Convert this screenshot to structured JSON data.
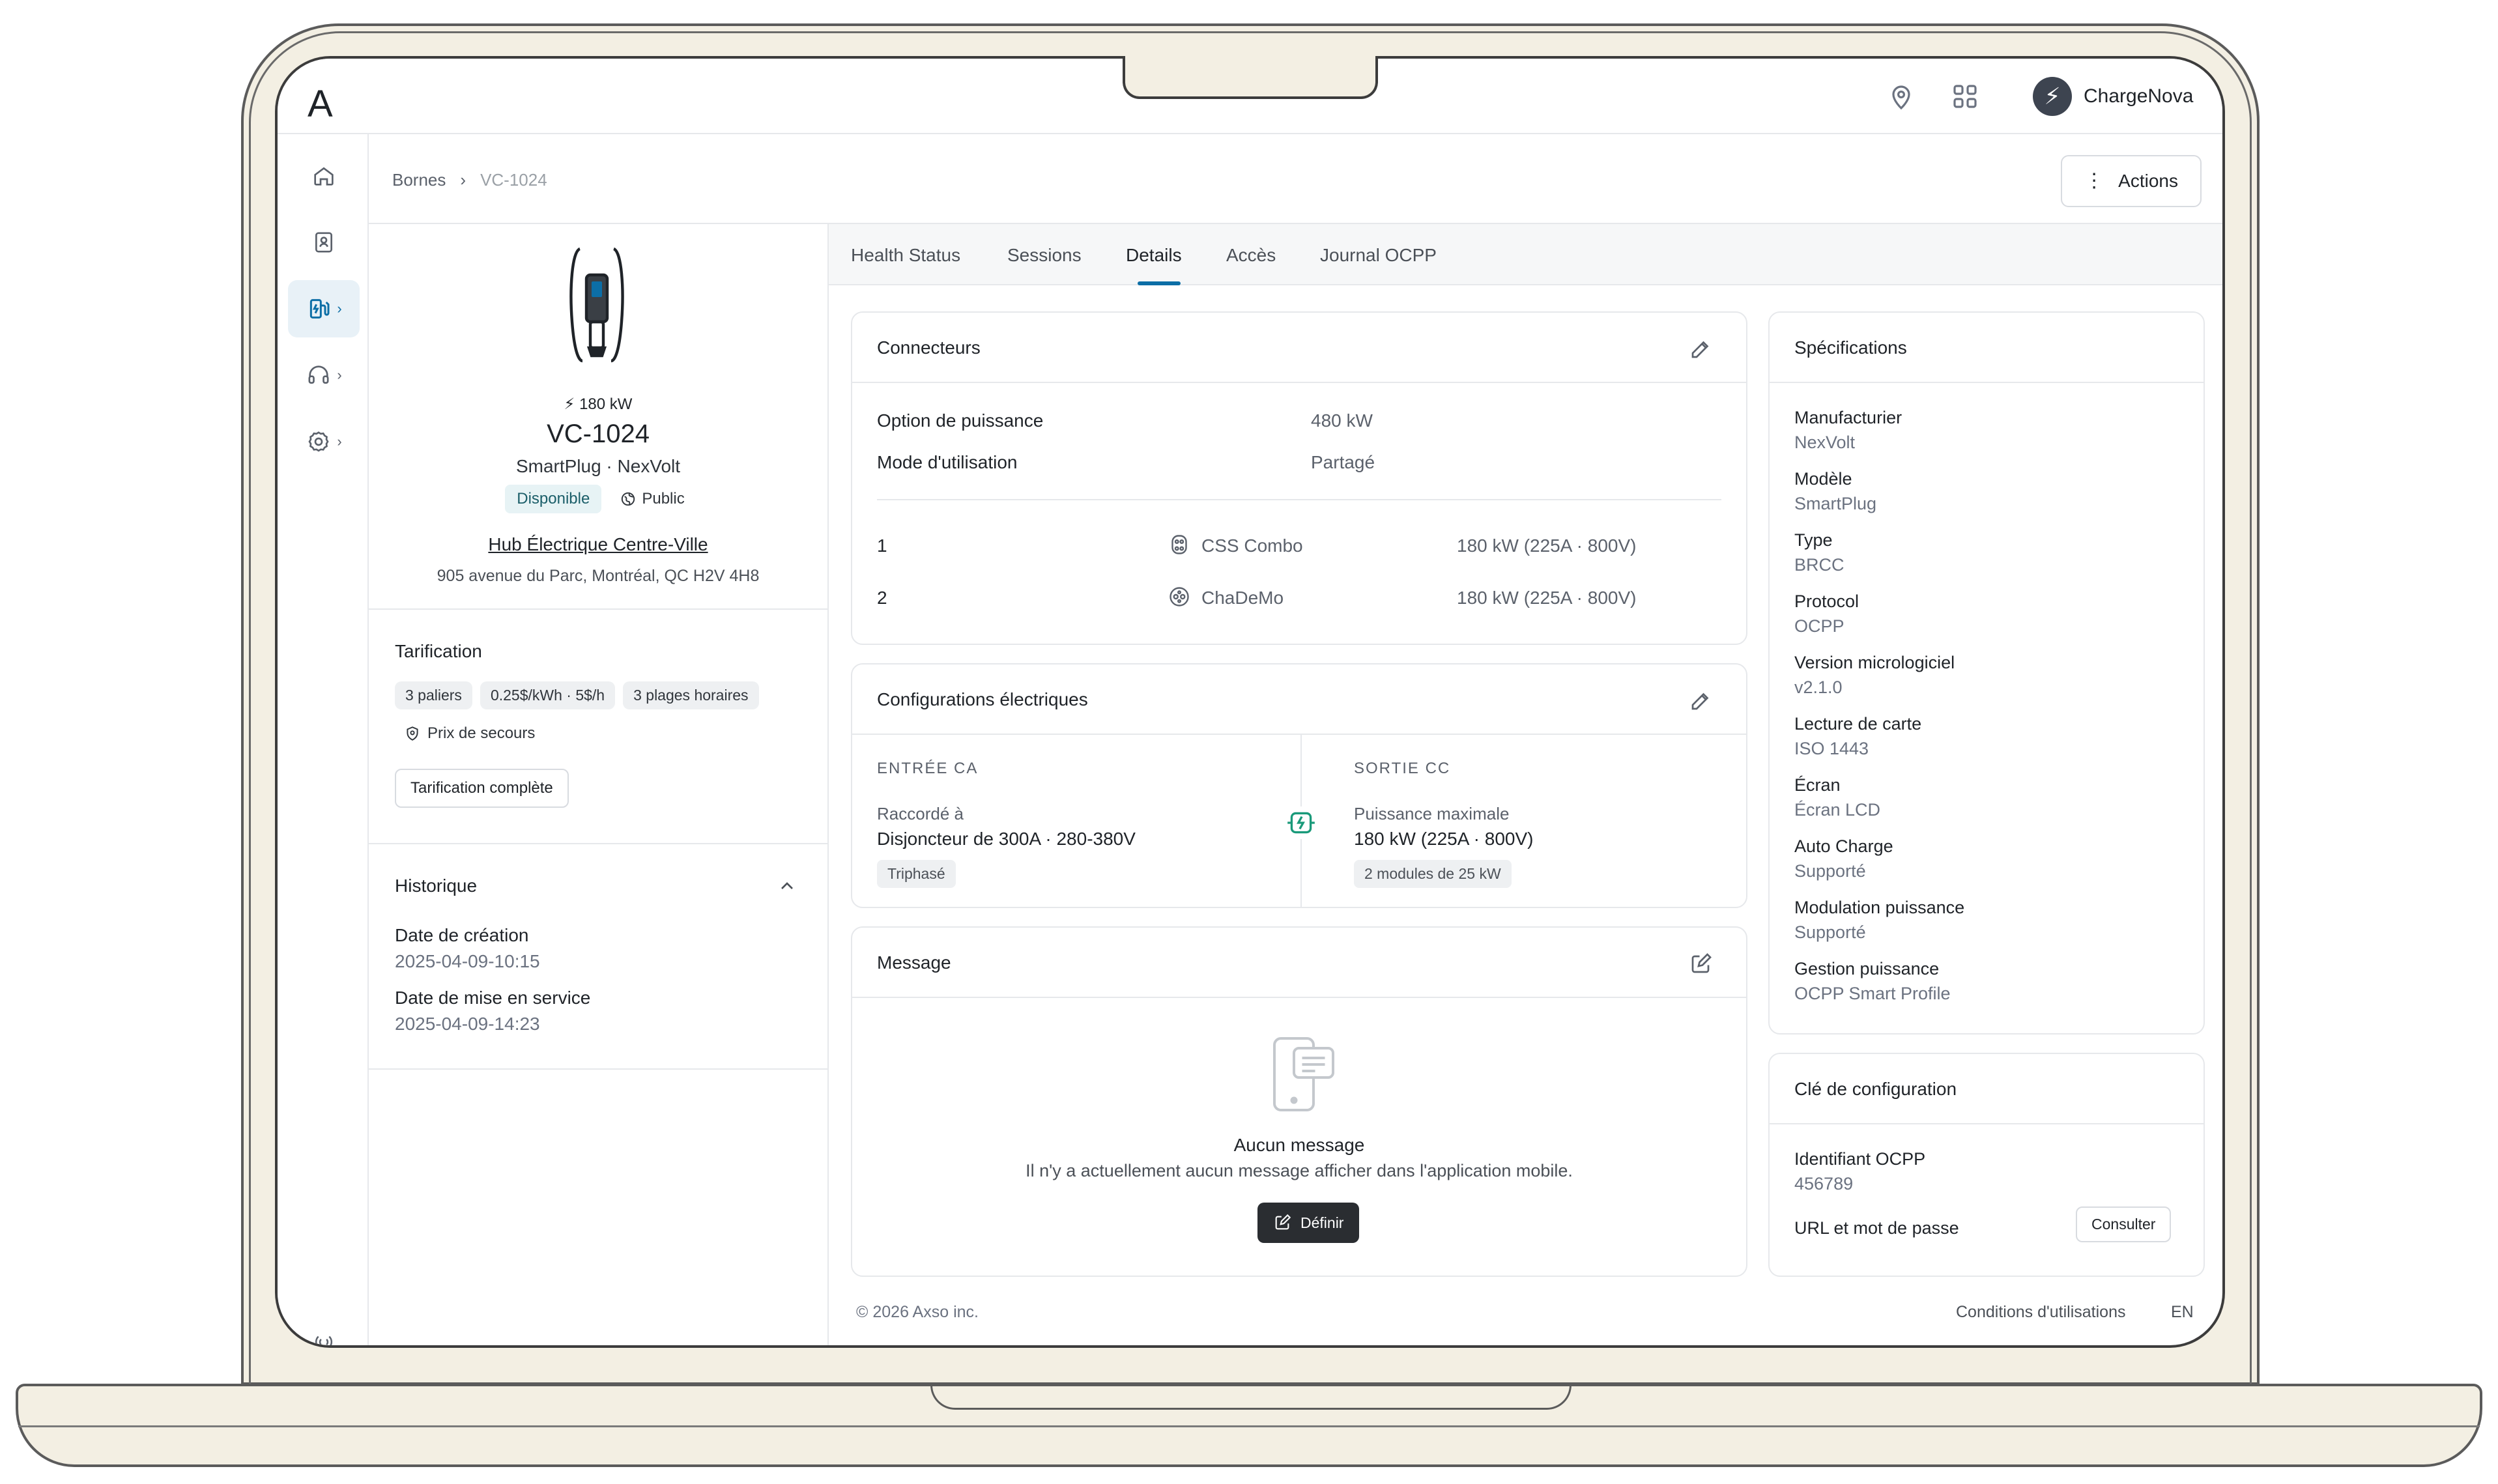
{
  "app": {
    "logo": "A",
    "user_name": "ChargeNova"
  },
  "breadcrumb": {
    "root": "Bornes",
    "separator": "›",
    "current": "VC-1024"
  },
  "actions_label": "Actions",
  "device": {
    "power": "180 kW",
    "name": "VC-1024",
    "model_brand": "SmartPlug · NexVolt",
    "status_badge": "Disponible",
    "access_badge": "Public",
    "site_name": "Hub Électrique Centre-Ville",
    "site_address": "905 avenue du Parc, Montréal, QC H2V 4H8"
  },
  "pricing": {
    "title": "Tarification",
    "chips": [
      "3 paliers",
      "0.25$/kWh · 5$/h",
      "3 plages horaires"
    ],
    "backup_label": "Prix de secours",
    "full_button": "Tarification complète"
  },
  "history": {
    "title": "Historique",
    "created_label": "Date de création",
    "created_value": "2025-04-09-10:15",
    "commissioned_label": "Date de mise en service",
    "commissioned_value": "2025-04-09-14:23"
  },
  "tabs": [
    "Health Status",
    "Sessions",
    "Details",
    "Accès",
    "Journal OCPP"
  ],
  "active_tab": "Details",
  "connectors": {
    "title": "Connecteurs",
    "power_option_label": "Option de puissance",
    "power_option_value": "480 kW",
    "usage_mode_label": "Mode d'utilisation",
    "usage_mode_value": "Partagé",
    "rows": [
      {
        "id": "1",
        "type": "CSS Combo",
        "spec": "180 kW (225A · 800V)"
      },
      {
        "id": "2",
        "type": "ChaDeMo",
        "spec": "180 kW (225A · 800V)"
      }
    ]
  },
  "electrical": {
    "title": "Configurations électriques",
    "ac_caption": "ENTRÉE CA",
    "ac_label": "Raccordé à",
    "ac_value": "Disjoncteur de 300A · 280-380V",
    "ac_pill": "Triphasé",
    "dc_caption": "SORTIE CC",
    "dc_label": "Puissance maximale",
    "dc_value": "180 kW (225A · 800V)",
    "dc_pill": "2 modules de 25 kW"
  },
  "message": {
    "title": "Message",
    "empty_title": "Aucun message",
    "empty_desc": "Il n'y a actuellement aucun message afficher dans l'application mobile.",
    "define_button": "Définir"
  },
  "specs": {
    "title": "Spécifications",
    "items": [
      {
        "k": "Manufacturier",
        "v": "NexVolt"
      },
      {
        "k": "Modèle",
        "v": "SmartPlug"
      },
      {
        "k": "Type",
        "v": "BRCC"
      },
      {
        "k": "Protocol",
        "v": "OCPP"
      },
      {
        "k": "Version micrologiciel",
        "v": "v2.1.0"
      },
      {
        "k": "Lecture de carte",
        "v": "ISO 1443"
      },
      {
        "k": "Écran",
        "v": "Écran LCD"
      },
      {
        "k": "Auto Charge",
        "v": "Supporté"
      },
      {
        "k": "Modulation puissance",
        "v": "Supporté"
      },
      {
        "k": "Gestion puissance",
        "v": "OCPP Smart Profile"
      }
    ]
  },
  "config_key": {
    "title": "Clé de configuration",
    "ocpp_id_label": "Identifiant OCPP",
    "ocpp_id_value": "456789",
    "url_label": "URL et mot de passe",
    "consult_button": "Consulter"
  },
  "footer": {
    "copyright": "© 2026 Axso inc.",
    "terms": "Conditions d'utilisations",
    "lang": "EN"
  },
  "colors": {
    "accent": "#0c6ea6",
    "status_green_bg": "#e7f3f5",
    "status_dot": "#2e9e5b",
    "laptop_body": "#f3efe3"
  }
}
